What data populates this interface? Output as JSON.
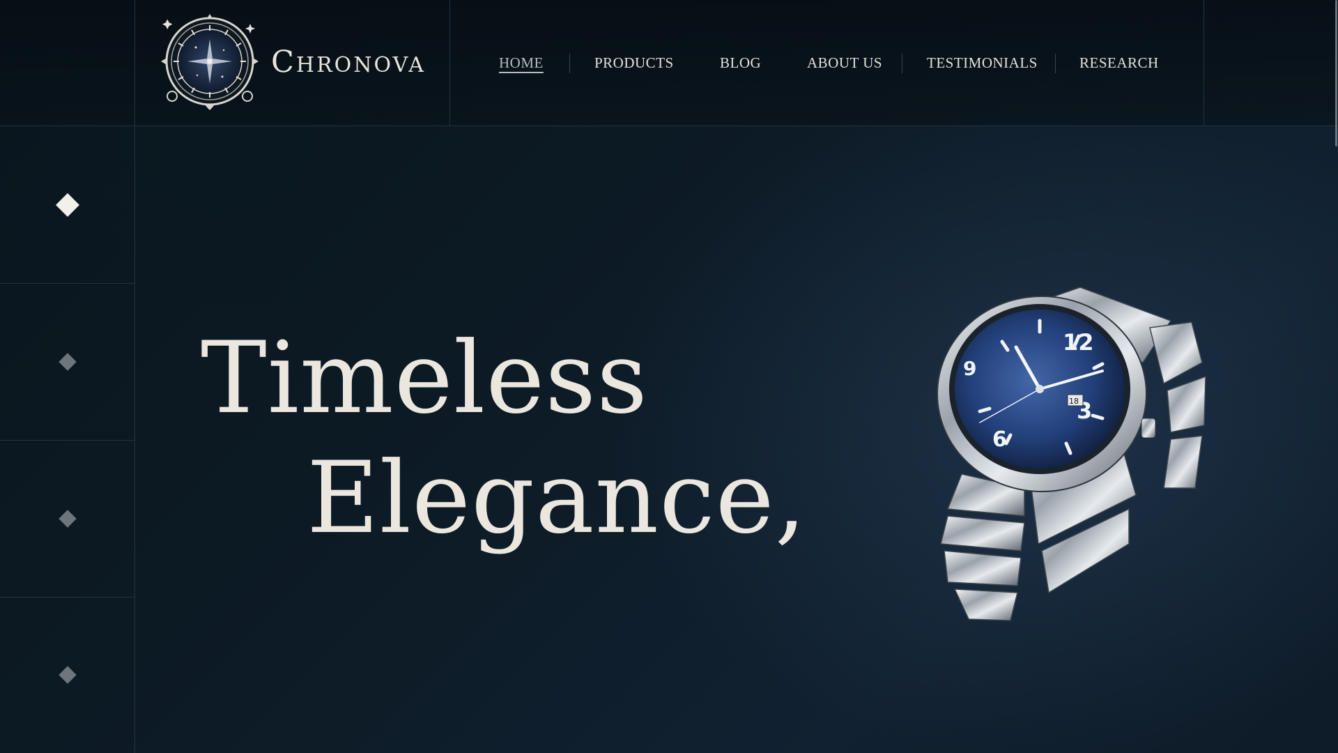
{
  "brand": {
    "name": "Chronova",
    "logo_icon": "ornate-clock-emblem-icon"
  },
  "nav": {
    "items": [
      {
        "label": "HOME",
        "active": true
      },
      {
        "label": "PRODUCTS",
        "active": false
      },
      {
        "label": "BLOG",
        "active": false
      },
      {
        "label": "ABOUT US",
        "active": false
      },
      {
        "label": "TESTIMONIALS",
        "active": false
      },
      {
        "label": "RESEARCH",
        "active": false
      }
    ]
  },
  "rail": {
    "slides": [
      {
        "icon": "diamond-icon",
        "active": true
      },
      {
        "icon": "diamond-icon",
        "active": false
      },
      {
        "icon": "diamond-icon",
        "active": false
      },
      {
        "icon": "diamond-icon",
        "active": false
      }
    ]
  },
  "hero": {
    "line1": "Timeless",
    "line2": "Elegance,",
    "image": "steel-wristwatch-blue-dial"
  },
  "watch_dial": {
    "numerals": [
      "12",
      "3",
      "6",
      "9"
    ],
    "date_window": "18"
  },
  "colors": {
    "background": "#0b1620",
    "text": "#e8e4dc",
    "accent_dial": "#2a4a86"
  }
}
